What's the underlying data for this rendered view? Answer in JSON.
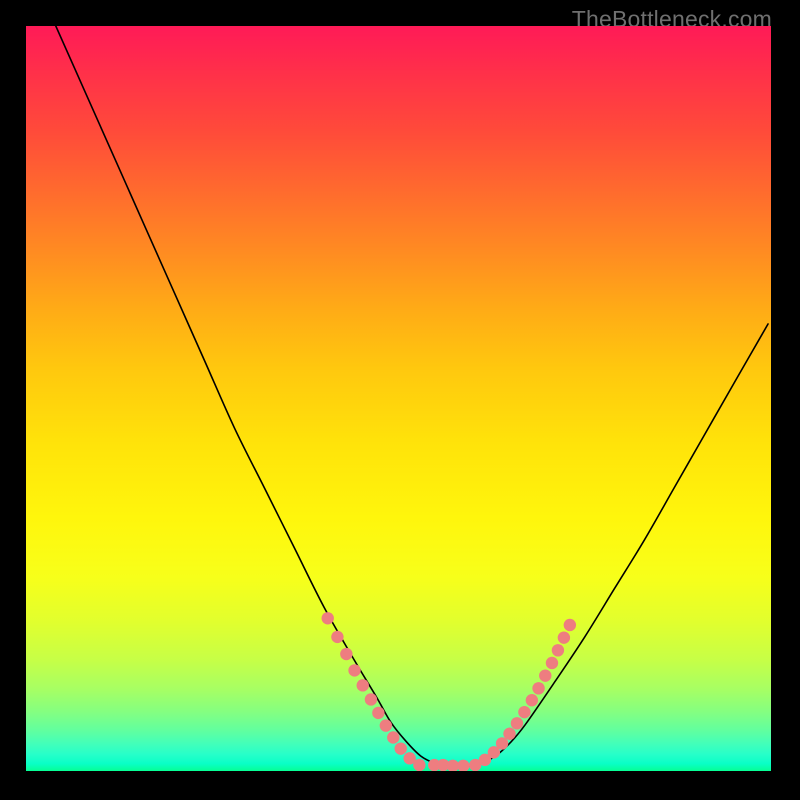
{
  "watermark": "TheBottleneck.com",
  "colors": {
    "dot_fill": "#ee7d80",
    "curve_stroke": "#000000"
  },
  "chart_data": {
    "type": "line",
    "title": "",
    "xlabel": "",
    "ylabel": "",
    "xlim": [
      0,
      100
    ],
    "ylim": [
      0,
      100
    ],
    "note": "Axis values are relative percentages; y is inverted (0 = top, 100 = bottom). Curve is a V-shaped bottleneck profile with flat bottom and scattered marker dots near the valley.",
    "series": [
      {
        "name": "bottleneck-curve",
        "x": [
          4,
          8,
          12,
          16,
          20,
          24,
          28,
          32,
          36,
          40,
          44,
          47,
          49,
          51,
          53,
          55,
          57,
          59,
          61,
          63,
          65,
          67,
          71,
          75,
          79,
          83,
          87,
          91,
          95,
          99.6
        ],
        "y": [
          0,
          9,
          18,
          27,
          36,
          45,
          54,
          62,
          70,
          78,
          85,
          90,
          93.5,
          96,
          98,
          99,
          99.4,
          99.4,
          99,
          98,
          96.2,
          93.8,
          88,
          82,
          75.5,
          69,
          62,
          55,
          48,
          40
        ]
      }
    ],
    "dots": [
      {
        "x": 40.5,
        "y": 79.5
      },
      {
        "x": 41.8,
        "y": 82.0
      },
      {
        "x": 43.0,
        "y": 84.3
      },
      {
        "x": 44.1,
        "y": 86.5
      },
      {
        "x": 45.2,
        "y": 88.5
      },
      {
        "x": 46.3,
        "y": 90.4
      },
      {
        "x": 47.3,
        "y": 92.2
      },
      {
        "x": 48.3,
        "y": 93.9
      },
      {
        "x": 49.3,
        "y": 95.5
      },
      {
        "x": 50.3,
        "y": 97.0
      },
      {
        "x": 51.5,
        "y": 98.3
      },
      {
        "x": 52.8,
        "y": 99.2
      },
      {
        "x": 54.8,
        "y": 99.2
      },
      {
        "x": 56.0,
        "y": 99.2
      },
      {
        "x": 57.3,
        "y": 99.3
      },
      {
        "x": 58.7,
        "y": 99.3
      },
      {
        "x": 60.3,
        "y": 99.2
      },
      {
        "x": 61.6,
        "y": 98.5
      },
      {
        "x": 62.8,
        "y": 97.5
      },
      {
        "x": 63.9,
        "y": 96.3
      },
      {
        "x": 64.9,
        "y": 95.0
      },
      {
        "x": 65.9,
        "y": 93.6
      },
      {
        "x": 66.9,
        "y": 92.1
      },
      {
        "x": 67.9,
        "y": 90.5
      },
      {
        "x": 68.8,
        "y": 88.9
      },
      {
        "x": 69.7,
        "y": 87.2
      },
      {
        "x": 70.6,
        "y": 85.5
      },
      {
        "x": 71.4,
        "y": 83.8
      },
      {
        "x": 72.2,
        "y": 82.1
      },
      {
        "x": 73.0,
        "y": 80.4
      }
    ]
  }
}
